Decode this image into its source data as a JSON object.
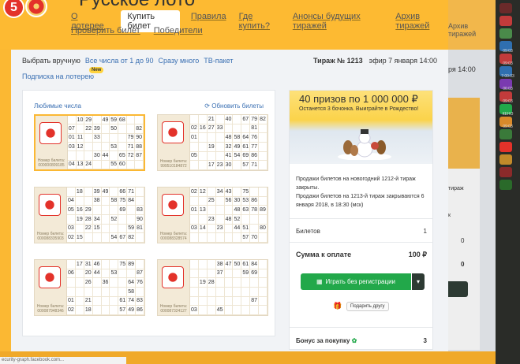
{
  "brand": "Русское лото",
  "nav": {
    "about": "О лотерее",
    "buy": "Купить билет",
    "rules": "Правила",
    "where": "Где купить?",
    "announce": "Анонсы будущих тиражей",
    "archive": "Архив тиражей",
    "check": "Проверить билет",
    "winners": "Победители"
  },
  "sub": {
    "manual": "Выбрать вручную",
    "all": "Все числа от 1 до 90",
    "many": "Сразу много",
    "tv": "ТВ-пакет",
    "subscribe": "Подписка на лотерею",
    "new_badge": "New"
  },
  "draw": {
    "number": "Тираж № 1213",
    "air": "эфир 7 января 14:00"
  },
  "tickets_panel": {
    "fav": "Любимые числа",
    "update": "Обновить билеты",
    "ticket_label": "Номер билета:"
  },
  "tickets": [
    {
      "num": "000000809185",
      "rows": [
        [
          "",
          "10",
          "29",
          "",
          "49",
          "59",
          "68",
          "",
          ""
        ],
        [
          "07",
          "",
          "22",
          "39",
          "",
          "50",
          "",
          "",
          "82"
        ],
        [
          "01",
          "11",
          "",
          "33",
          "",
          "",
          "",
          "79",
          "90"
        ],
        [
          "03",
          "12",
          "",
          "",
          "",
          "53",
          "",
          "71",
          "88"
        ],
        [
          "",
          "",
          "",
          "30",
          "44",
          "",
          "65",
          "72",
          "87"
        ],
        [
          "04",
          "13",
          "24",
          "",
          "",
          "55",
          "60",
          "",
          ""
        ]
      ]
    },
    {
      "num": "999510184872",
      "rows": [
        [
          "",
          "",
          "21",
          "",
          "40",
          "",
          "67",
          "79",
          "82"
        ],
        [
          "02",
          "16",
          "27",
          "33",
          "",
          "",
          "",
          "81",
          ""
        ],
        [
          "01",
          "",
          "",
          "",
          "48",
          "58",
          "64",
          "76",
          ""
        ],
        [
          "",
          "",
          "19",
          "",
          "32",
          "49",
          "61",
          "77",
          ""
        ],
        [
          "05",
          "",
          "",
          "",
          "41",
          "54",
          "69",
          "86",
          ""
        ],
        [
          "",
          "",
          "17",
          "23",
          "30",
          "",
          "57",
          "71",
          ""
        ]
      ]
    },
    {
      "num": "000088335903",
      "rows": [
        [
          "",
          "18",
          "",
          "39",
          "49",
          "",
          "66",
          "71",
          ""
        ],
        [
          "04",
          "",
          "",
          "38",
          "",
          "58",
          "75",
          "84",
          ""
        ],
        [
          "05",
          "16",
          "29",
          "",
          "",
          "",
          "69",
          "",
          "83"
        ],
        [
          "",
          "19",
          "28",
          "34",
          "",
          "52",
          "",
          "",
          "90"
        ],
        [
          "03",
          "",
          "22",
          "15",
          "",
          "",
          "",
          "59",
          "81"
        ],
        [
          "02",
          "15",
          "",
          "",
          "",
          "54",
          "67",
          "82",
          ""
        ]
      ]
    },
    {
      "num": "000088328574",
      "rows": [
        [
          "02",
          "12",
          "",
          "34",
          "43",
          "",
          "75",
          ""
        ],
        [
          "",
          "",
          "25",
          "",
          "56",
          "30",
          "53",
          "86",
          ""
        ],
        [
          "01",
          "13",
          "",
          "",
          "",
          "48",
          "63",
          "78",
          "89"
        ],
        [
          "",
          "",
          "23",
          "",
          "48",
          "52",
          "",
          "",
          ""
        ],
        [
          "03",
          "14",
          "",
          "23",
          "",
          "44",
          "51",
          "",
          "80"
        ],
        [
          "",
          "",
          "",
          "",
          "",
          "",
          "57",
          "70",
          ""
        ]
      ]
    },
    {
      "num": "000087948346",
      "rows": [
        [
          "",
          "17",
          "31",
          "46",
          "",
          "",
          "75",
          "89",
          ""
        ],
        [
          "06",
          "",
          "20",
          "44",
          "",
          "53",
          "",
          "",
          "87"
        ],
        [
          "",
          "",
          "26",
          "",
          "36",
          "",
          "",
          "64",
          "76"
        ],
        [
          "",
          "",
          "",
          "",
          "",
          "",
          "",
          "58",
          ""
        ],
        [
          "01",
          "",
          "21",
          "",
          "",
          "",
          "61",
          "74",
          "83"
        ],
        [
          "02",
          "",
          "18",
          "",
          "",
          "",
          "57",
          "49",
          "86"
        ]
      ]
    },
    {
      "num": "000087324127",
      "rows": [
        [
          "",
          "",
          "",
          "38",
          "47",
          "50",
          "61",
          "84",
          ""
        ],
        [
          "",
          "",
          "",
          "37",
          "",
          "",
          "59",
          "69",
          ""
        ],
        [
          "",
          "19",
          "28",
          "",
          "",
          "",
          "",
          "",
          ""
        ],
        [
          "",
          "",
          "",
          "",
          "",
          "",
          "",
          "",
          ""
        ],
        [
          "",
          "",
          "",
          "",
          "",
          "",
          "",
          "87",
          ""
        ],
        [
          "03",
          "",
          "",
          "45",
          "",
          "",
          "",
          "",
          ""
        ]
      ]
    }
  ],
  "right": {
    "banner_title": "40 призов по 1 000 000 ₽",
    "banner_sub": "Останется 3 бочонка. Выиграйте в Рождество!",
    "info1": "Продажи билетов на  новогодний 1212-й тираж закрыты.",
    "info2": "Продажи билетов на 1213-й тираж закрываются 6 января 2018, в 18:30 (мск)",
    "tickets_label": "Билетов",
    "tickets_val": "1",
    "sum_label": "Сумма к оплате",
    "sum_val": "100 ₽",
    "play": "Играть без регистрации",
    "gift": "Подарить другу",
    "bonus_label": "Бонус за покупку",
    "bonus_val": "3"
  },
  "ghost": {
    "archive": "Архив тиражей",
    "time": "ря 14:00",
    "tiraz": "тираж",
    "k": "к"
  },
  "status": "ecurity-graph.facebook.com...",
  "side": [
    {
      "c": "#6b2a2a",
      "t": ""
    },
    {
      "c": "#c23b3b",
      "t": ""
    },
    {
      "c": "#4a8a4a",
      "t": ""
    },
    {
      "c": "#2f6fb0",
      "t": "09:03"
    },
    {
      "c": "#c23b3b",
      "t": "09:03"
    },
    {
      "c": "#2f6fb0",
      "t": "7:00:03"
    },
    {
      "c": "#7a3ab0",
      "t": "06:03"
    },
    {
      "c": "#c23b3b",
      "t": "09:03"
    },
    {
      "c": "#22a84a",
      "t": "КЕНО"
    },
    {
      "c": "#d98a2a",
      "t": "09:03"
    },
    {
      "c": "#3a7a3a",
      "t": ""
    },
    {
      "c": "#e3322a",
      "t": ""
    },
    {
      "c": "#c28a2a",
      "t": ""
    },
    {
      "c": "#8a2a2a",
      "t": ""
    },
    {
      "c": "#2a6a2a",
      "t": ""
    }
  ]
}
